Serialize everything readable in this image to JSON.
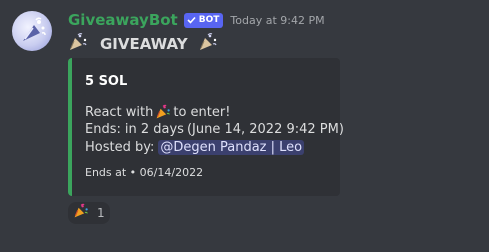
{
  "message": {
    "username": "GiveawayBot",
    "bot_badge": "BOT",
    "timestamp": "Today at 9:42 PM",
    "title": "GIVEAWAY",
    "icons": {
      "party_popper": "party-popper-icon",
      "check": "check-icon",
      "avatar": "confetti-avatar"
    },
    "colors": {
      "username": "#3ba55d",
      "embed_border": "#3ba55d",
      "bot_badge": "#5865f2"
    }
  },
  "embed": {
    "title": "5 SOL",
    "react_prefix": "React with",
    "react_suffix": "to enter!",
    "ends_label": "Ends:",
    "ends_relative": "in 2 days",
    "ends_absolute": "June 14, 2022 9:42 PM",
    "hosted_label": "Hosted by:",
    "host_mention": "@Degen Pandaz | Leo",
    "footer": "Ends at • 06/14/2022"
  },
  "reaction": {
    "emoji": "party-popper-icon",
    "count": "1"
  }
}
